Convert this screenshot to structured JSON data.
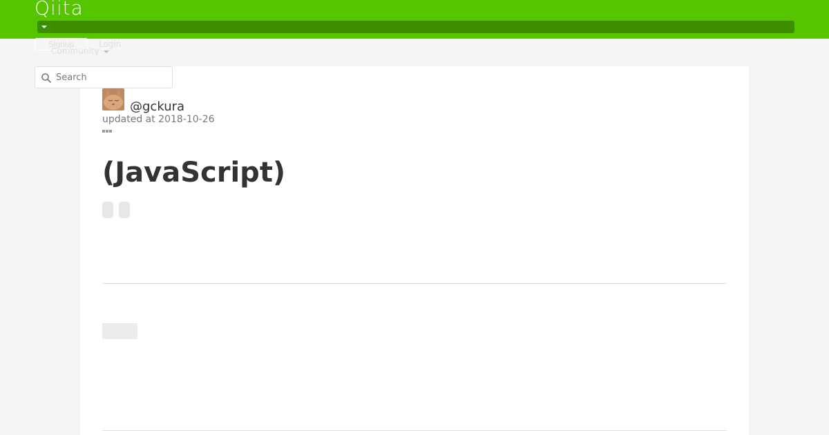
{
  "header": {
    "logo": "Qiita",
    "signup_label": "Signup",
    "login_label": "Login",
    "community_label": "Community",
    "accent_color": "#55c500"
  },
  "search": {
    "placeholder": "Search",
    "icon": "search-icon"
  },
  "article": {
    "author": "@gckura",
    "updated": "updated at 2018-10-26",
    "title": "(JavaScript)",
    "tags": [
      "",
      ""
    ]
  }
}
